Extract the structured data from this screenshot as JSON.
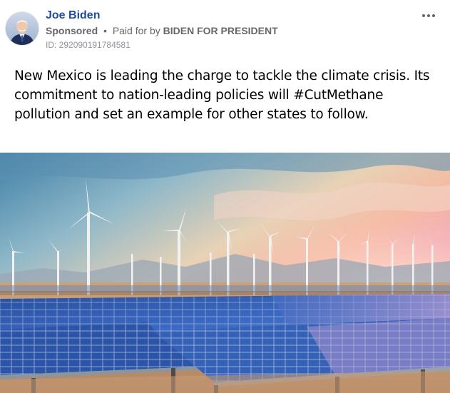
{
  "post": {
    "author_name": "Joe Biden",
    "sponsored_label": "Sponsored",
    "separator": "•",
    "paid_for_prefix": "Paid for by",
    "payer": "BIDEN FOR PRESIDENT",
    "ad_id": "ID: 292090191784581",
    "more_icon": "more-horizontal-icon",
    "body_text": "New Mexico is leading the charge to tackle the climate crisis. Its commitment to nation-leading policies will #CutMethane pollution and set an example for other states to follow.",
    "image_subject": "solar-panels-and-wind-turbines-photo"
  },
  "colors": {
    "name_blue": "#1d4d9c",
    "secondary_gray": "#65676b"
  }
}
